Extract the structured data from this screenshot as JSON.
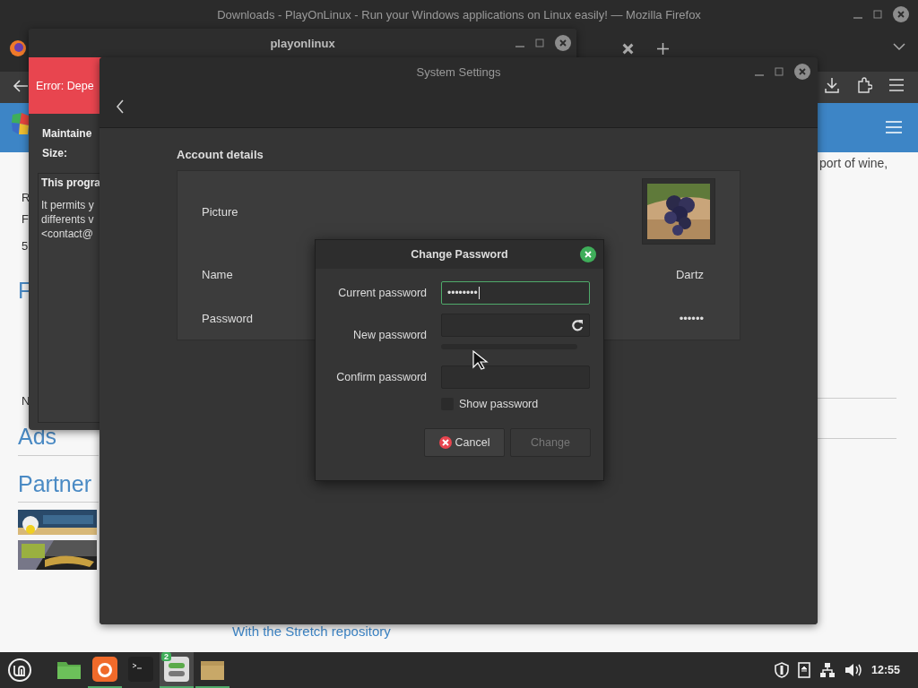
{
  "browser": {
    "title": "Downloads - PlayOnLinux - Run your Windows applications on Linux easily! — Mozilla Firefox",
    "page": {
      "fragments": [
        "R",
        "F",
        "5",
        "N"
      ],
      "headings": [
        "F",
        "Ads",
        "Partner"
      ],
      "right_text": "port of wine,",
      "link": "With the Stretch repository"
    }
  },
  "playonlinux": {
    "title": "playonlinux",
    "error": "Error: Depe",
    "fields": [
      "Maintaine",
      "Size:"
    ],
    "description_title": "This progra",
    "description_lines": [
      "It permits y",
      "differents v",
      "<contact@"
    ]
  },
  "settings": {
    "title": "System Settings",
    "section": "Account details",
    "rows": [
      {
        "label": "Picture",
        "kind": "picture"
      },
      {
        "label": "Name",
        "kind": "text",
        "value": "Dartz"
      },
      {
        "label": "Password",
        "kind": "text",
        "value": "••••••"
      }
    ]
  },
  "dialog": {
    "title": "Change Password",
    "fields": [
      {
        "label": "Current password",
        "kind": "plain",
        "value": "••••••••",
        "focused": true
      },
      {
        "label": "New password",
        "kind": "generate",
        "focused": false
      },
      {
        "label": "Confirm password",
        "kind": "plain",
        "focused": false
      }
    ],
    "strength": {
      "level": 0
    },
    "show_password": {
      "label": "Show password",
      "checked": false
    },
    "buttons": [
      {
        "label": "Cancel",
        "kind": "cancel",
        "disabled": false
      },
      {
        "label": "Change",
        "kind": "plain",
        "disabled": true
      }
    ]
  },
  "taskbar": {
    "apps": [
      {
        "kind": "folder",
        "running": false,
        "active": false
      },
      {
        "kind": "firefox",
        "running": true,
        "active": false
      },
      {
        "kind": "terminal",
        "running": false,
        "active": false
      },
      {
        "kind": "settings",
        "running": true,
        "active": true,
        "badge": "2"
      },
      {
        "kind": "package",
        "running": true,
        "active": false
      }
    ],
    "clock": "12:55"
  }
}
